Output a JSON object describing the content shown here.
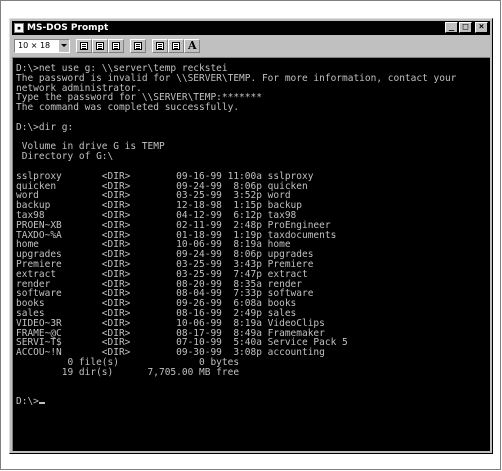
{
  "window": {
    "title": "MS-DOS Prompt",
    "font_size_value": "10 × 18",
    "toolbar_font_button": "A"
  },
  "console": {
    "lines": [
      "D:\\>net use g: \\\\server\\temp reckstei",
      "The password is invalid for \\\\SERVER\\TEMP. For more information, contact your",
      "network administrator.",
      "Type the password for \\\\SERVER\\TEMP:*******",
      "The command was completed successfully.",
      "",
      "D:\\>dir g:",
      "",
      " Volume in drive G is TEMP",
      " Directory of G:\\",
      "",
      "sslproxy       <DIR>        09-16-99 11:00a sslproxy",
      "quicken        <DIR>        09-24-99  8:06p quicken",
      "word           <DIR>        03-25-99  3:52p word",
      "backup         <DIR>        12-18-98  1:15p backup",
      "tax98          <DIR>        04-12-99  6:12p tax98",
      "PROEN~XB       <DIR>        02-11-99  2:48p ProEngineer",
      "TAXDO~%A       <DIR>        01-18-99  1:19p taxdocuments",
      "home           <DIR>        10-06-99  8:19a home",
      "upgrades       <DIR>        09-24-99  8:06p upgrades",
      "Premiere       <DIR>        03-25-99  3:43p Premiere",
      "extract        <DIR>        03-25-99  7:47p extract",
      "render         <DIR>        08-20-99  8:35a render",
      "software       <DIR>        08-04-99  7:33p software",
      "books          <DIR>        09-26-99  6:08a books",
      "sales          <DIR>        08-16-99  2:49p sales",
      "VIDEO~3R       <DIR>        10-06-99  8:19a VideoClips",
      "FRAME~@C       <DIR>        08-17-99  8:49a Framemaker",
      "SERVI~T$       <DIR>        07-10-99  5:40a Service Pack 5",
      "ACCOU~!N       <DIR>        09-30-99  3:08p accounting",
      "         0 file(s)              0 bytes",
      "        19 dir(s)      7,705.00 MB free",
      "",
      ""
    ],
    "prompt": "D:\\>"
  }
}
